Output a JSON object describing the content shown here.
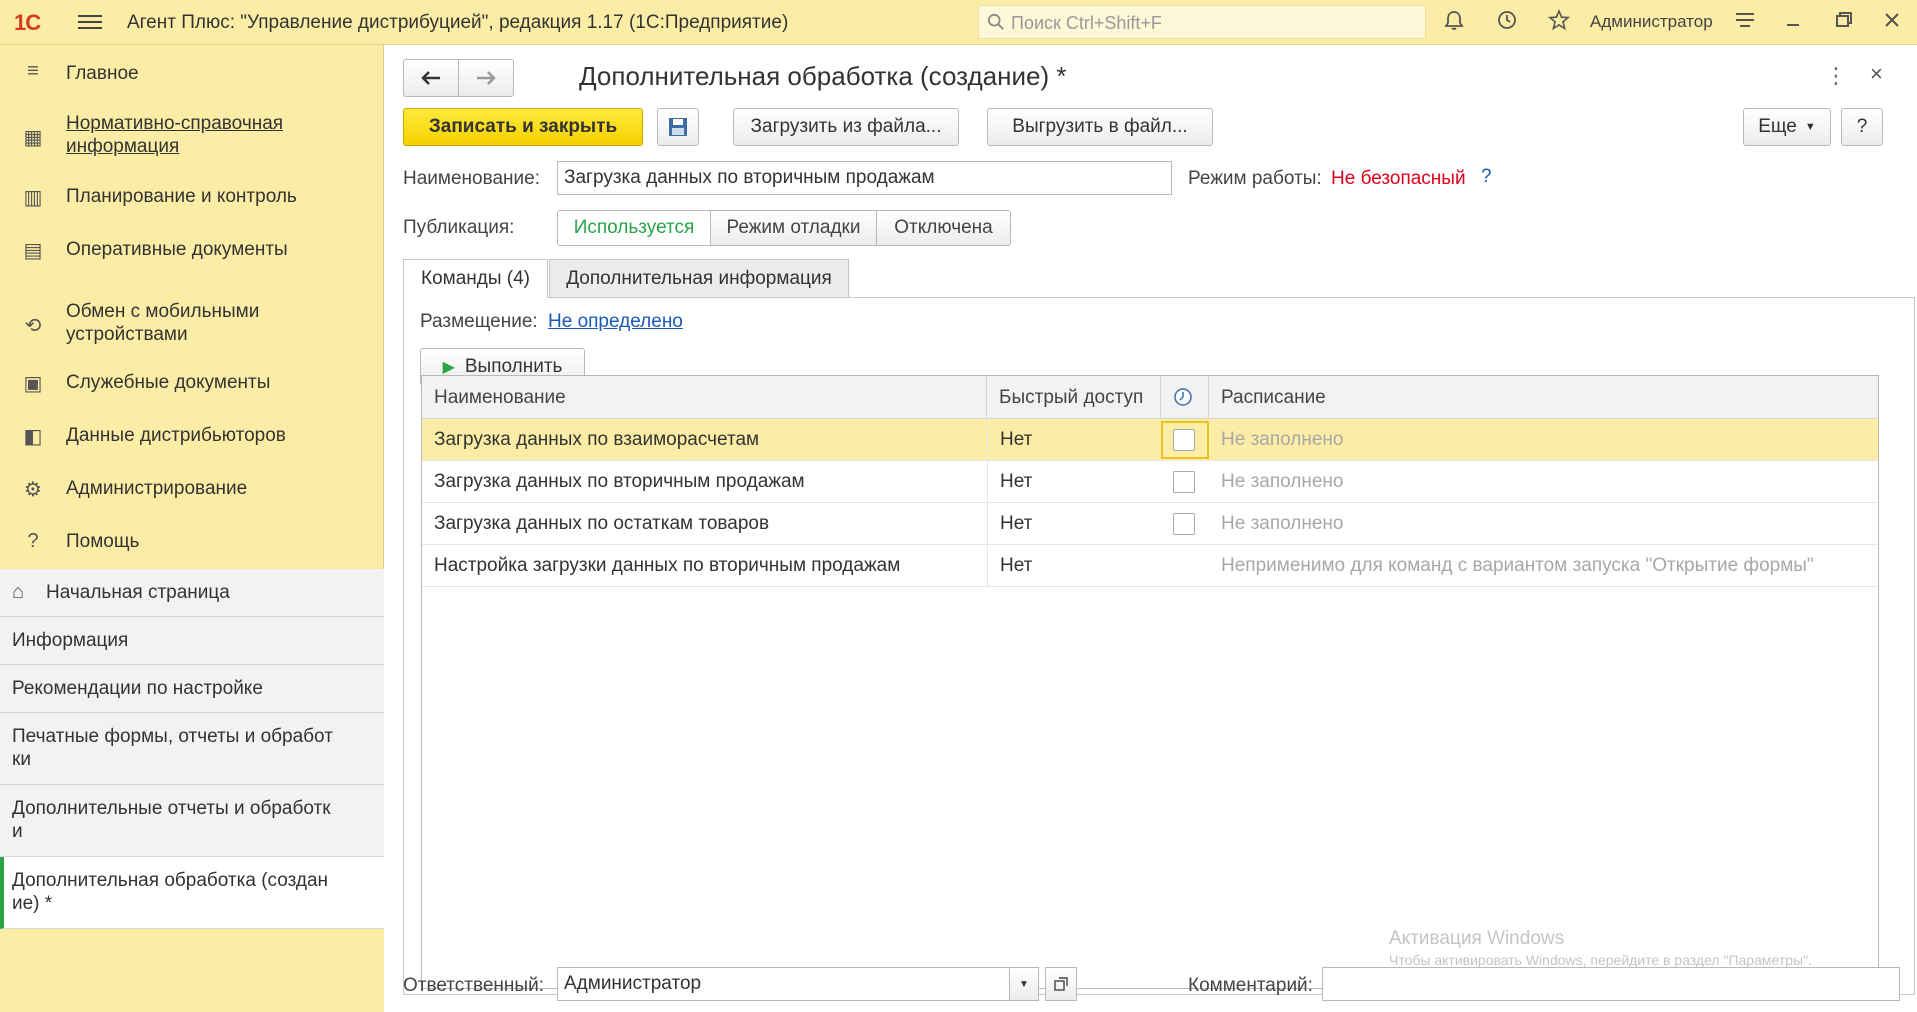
{
  "app": {
    "logo": "1С",
    "title": "Агент Плюс: \"Управление дистрибуцией\", редакция 1.17  (1С:Предприятие)",
    "search_placeholder": "Поиск Ctrl+Shift+F",
    "user": "Администратор"
  },
  "sidebar": {
    "sections": [
      {
        "label": "Главное",
        "icon": "menu-lines-icon"
      },
      {
        "label": "Нормативно-справочная информация",
        "icon": "grid-icon"
      },
      {
        "label": "Планирование и контроль",
        "icon": "bar-chart-icon"
      },
      {
        "label": "Оперативные документы",
        "icon": "documents-icon"
      },
      {
        "label": "Обмен с мобильными устройствами",
        "icon": "sync-icon"
      },
      {
        "label": "Служебные документы",
        "icon": "service-docs-icon"
      },
      {
        "label": "Данные дистрибьюторов",
        "icon": "distributor-data-icon"
      },
      {
        "label": "Администрирование",
        "icon": "gear-icon"
      },
      {
        "label": "Помощь",
        "icon": "question-icon"
      }
    ],
    "open_windows": [
      {
        "label": "Начальная страница"
      },
      {
        "label": "Информация"
      },
      {
        "label": "Рекомендации по настройке"
      },
      {
        "label": "Печатные формы, отчеты и обработ\nки"
      },
      {
        "label": "Дополнительные отчеты и обработк\nи"
      },
      {
        "label": "Дополнительная обработка (создан\nие) *"
      }
    ]
  },
  "form": {
    "title": "Дополнительная обработка (создание) *",
    "toolbar": {
      "save_close": "Записать и закрыть",
      "load_file": "Загрузить из файла...",
      "export_file": "Выгрузить в файл...",
      "more": "Еще",
      "help": "?"
    },
    "name_label": "Наименование:",
    "name_value": "Загрузка данных по вторичным продажам",
    "mode_label": "Режим работы:",
    "mode_value": "Не безопасный",
    "mode_help": "?",
    "publication_label": "Публикация:",
    "publication_options": [
      "Используется",
      "Режим отладки",
      "Отключена"
    ],
    "tabs": [
      "Команды (4)",
      "Дополнительная информация"
    ],
    "placement_label": "Размещение:",
    "placement_value": "Не определено",
    "run_button": "Выполнить",
    "grid": {
      "columns": [
        "Наименование",
        "Быстрый доступ",
        "",
        "Расписание"
      ],
      "rows": [
        {
          "name": "Загрузка данных по взаиморасчетам",
          "quick": "Нет",
          "checked": false,
          "schedule": "Не заполнено"
        },
        {
          "name": "Загрузка данных по вторичным продажам",
          "quick": "Нет",
          "checked": false,
          "schedule": "Не заполнено"
        },
        {
          "name": "Загрузка данных по остаткам товаров",
          "quick": "Нет",
          "checked": false,
          "schedule": "Не заполнено"
        },
        {
          "name": "Настройка загрузки данных по вторичным продажам",
          "quick": "Нет",
          "checked": null,
          "schedule": "Неприменимо для команд с вариантом запуска \"Открытие формы\""
        }
      ]
    },
    "responsible_label": "Ответственный:",
    "responsible_value": "Администратор",
    "comment_label": "Комментарий:",
    "comment_value": ""
  },
  "watermark": {
    "line1": "Активация Windows",
    "line2": "Чтобы активировать Windows, перейдите в раздел \"Параметры\"."
  },
  "colors": {
    "accent_yellow": "#fbeda5",
    "primary_button": "#f5d000",
    "active_green": "#2aa44a",
    "danger_red": "#e0001b",
    "link_blue": "#1a5ab8"
  }
}
